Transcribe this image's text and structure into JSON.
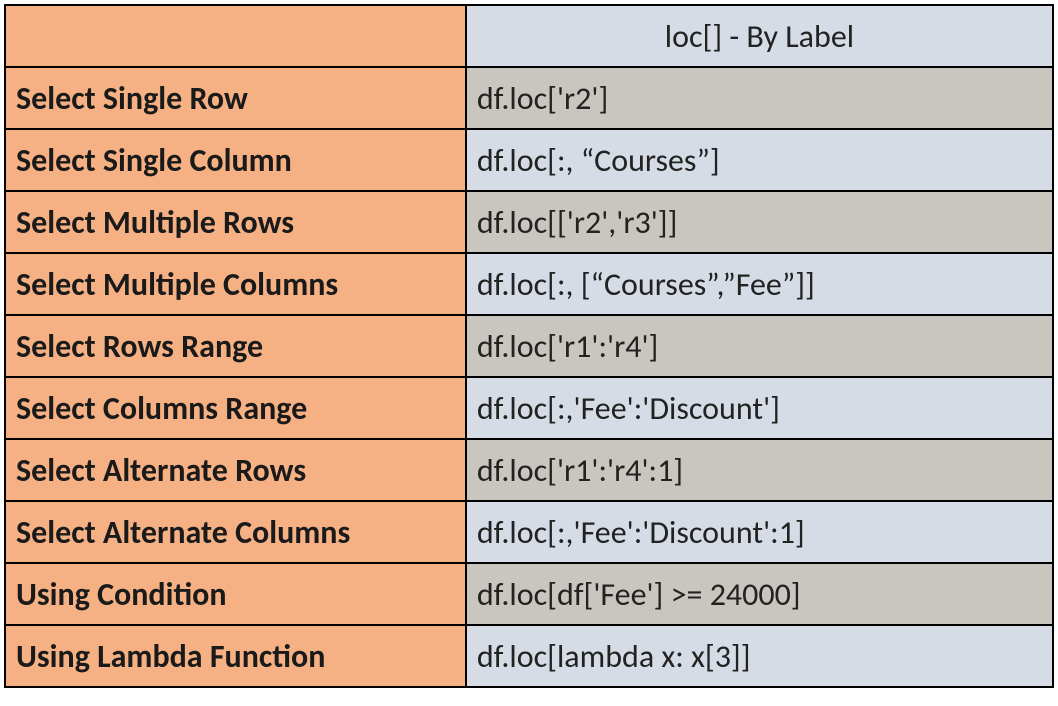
{
  "header": {
    "left": "",
    "right": "loc[] - By Label"
  },
  "rows": [
    {
      "label": "Select Single Row",
      "code": "df.loc['r2']",
      "shade": "gray"
    },
    {
      "label": "Select Single Column",
      "code": "df.loc[:, “Courses”]",
      "shade": "blue"
    },
    {
      "label": "Select Multiple Rows",
      "code": "df.loc[['r2','r3']]",
      "shade": "gray"
    },
    {
      "label": "Select Multiple Columns",
      "code": "df.loc[:, [“Courses”,”Fee”]]",
      "shade": "blue"
    },
    {
      "label": "Select Rows Range",
      "code": "df.loc['r1':'r4']",
      "shade": "gray"
    },
    {
      "label": "Select Columns Range",
      "code": "df.loc[:,'Fee':'Discount']",
      "shade": "blue"
    },
    {
      "label": "Select Alternate Rows",
      "code": "df.loc['r1':'r4':1]",
      "shade": "gray"
    },
    {
      "label": "Select Alternate Columns",
      "code": "df.loc[:,'Fee':'Discount':1]",
      "shade": "blue"
    },
    {
      "label": "Using Condition",
      "code": "df.loc[df['Fee'] >= 24000]",
      "shade": "gray"
    },
    {
      "label": "Using Lambda Function",
      "code": "df.loc[lambda x: x[3]]",
      "shade": "blue"
    }
  ]
}
